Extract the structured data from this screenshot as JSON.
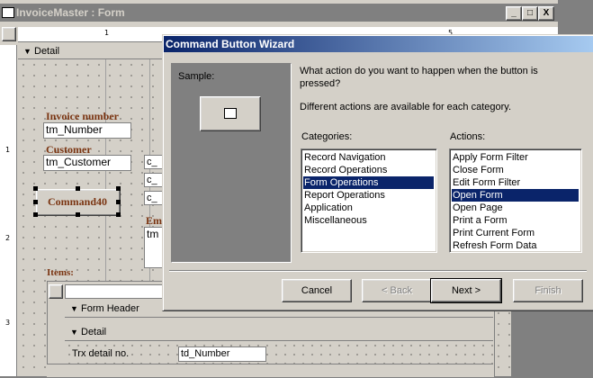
{
  "access_window": {
    "title": "InvoiceMaster : Form",
    "minimize": "_",
    "maximize": "□",
    "close": "X",
    "section_detail": "Detail",
    "ruler_marks": [
      "1",
      "5"
    ],
    "vruler_marks": [
      "1",
      "2",
      "3"
    ]
  },
  "form": {
    "invoice_number_label": "Invoice number",
    "invoice_number_field": "tm_Number",
    "customer_label": "Customer",
    "customer_field": "tm_Customer",
    "command_button": "Command40",
    "em_label": "Em",
    "tm_field": "tm",
    "c_field": "c_",
    "items_label": "Items:"
  },
  "subform": {
    "form_header": "Form Header",
    "detail": "Detail",
    "trx_label": "Trx detail no.",
    "td_number_field": "td_Number"
  },
  "wizard": {
    "title": "Command Button Wizard",
    "sample_label": "Sample:",
    "question": "What action do you want to happen when the button is pressed?",
    "question_line1": "What action do you want to happen when the button is",
    "question_line2": "pressed?",
    "info": "Different actions are available for each category.",
    "categories_label": "Categories:",
    "actions_label": "Actions:",
    "categories": [
      "Record Navigation",
      "Record Operations",
      "Form Operations",
      "Report Operations",
      "Application",
      "Miscellaneous"
    ],
    "categories_selected": "Form Operations",
    "actions": [
      "Apply Form Filter",
      "Close Form",
      "Edit Form Filter",
      "Open Form",
      "Open Page",
      "Print a Form",
      "Print Current Form",
      "Refresh Form Data"
    ],
    "actions_selected": "Open Form",
    "buttons": {
      "cancel": "Cancel",
      "back": "< Back",
      "next": "Next >",
      "finish": "Finish"
    }
  }
}
